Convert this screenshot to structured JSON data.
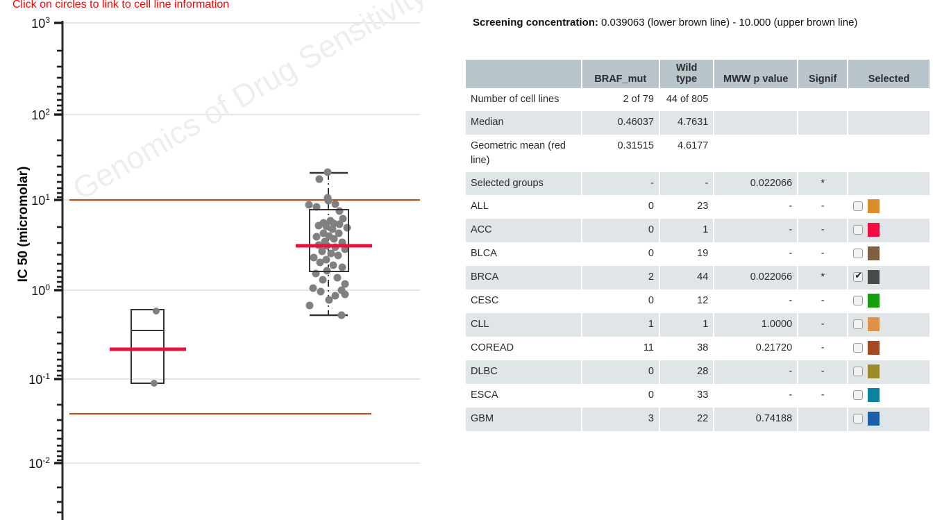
{
  "plot": {
    "title": "Click on circles to link to cell line information",
    "y_axis_label": "IC 50 (micromolar)",
    "watermark": "Genomics of Drug Sensitivity"
  },
  "info": {
    "screening_label": "Screening concentration:",
    "screening_value": " 0.039063 (lower brown line) - 10.000 (upper brown line)"
  },
  "table": {
    "headers": [
      "",
      "BRAF_mut",
      "Wild type",
      "MWW p value",
      "Signif",
      "Selected"
    ],
    "stat_rows": [
      {
        "label": "Number of cell lines",
        "braf": "2 of 79",
        "wild": "44 of 805",
        "mww": "",
        "signif": "",
        "alt": false
      },
      {
        "label": "Median",
        "braf": "0.46037",
        "wild": "4.7631",
        "mww": "",
        "signif": "",
        "alt": true
      },
      {
        "label": "Geometric mean (red line)",
        "braf": "0.31515",
        "wild": "4.6177",
        "mww": "",
        "signif": "",
        "alt": false
      },
      {
        "label": "Selected groups",
        "braf": "-",
        "wild": "-",
        "mww": "0.022066",
        "signif": "*",
        "alt": true
      }
    ],
    "tissue_rows": [
      {
        "label": "ALL",
        "braf": "0",
        "wild": "23",
        "mww": "-",
        "signif": "-",
        "checked": false,
        "color": "#d98d2b",
        "alt": false
      },
      {
        "label": "ACC",
        "braf": "0",
        "wild": "1",
        "mww": "-",
        "signif": "-",
        "checked": false,
        "color": "#f50a42",
        "alt": true
      },
      {
        "label": "BLCA",
        "braf": "0",
        "wild": "19",
        "mww": "-",
        "signif": "-",
        "checked": false,
        "color": "#7d6141",
        "alt": false
      },
      {
        "label": "BRCA",
        "braf": "2",
        "wild": "44",
        "mww": "0.022066",
        "signif": "*",
        "checked": true,
        "color": "#4a4a4a",
        "alt": true
      },
      {
        "label": "CESC",
        "braf": "0",
        "wild": "12",
        "mww": "-",
        "signif": "-",
        "checked": false,
        "color": "#159e0d",
        "alt": false
      },
      {
        "label": "CLL",
        "braf": "1",
        "wild": "1",
        "mww": "1.0000",
        "signif": "-",
        "checked": false,
        "color": "#dd9248",
        "alt": true
      },
      {
        "label": "COREAD",
        "braf": "11",
        "wild": "38",
        "mww": "0.21720",
        "signif": "-",
        "checked": false,
        "color": "#a44a22",
        "alt": false
      },
      {
        "label": "DLBC",
        "braf": "0",
        "wild": "28",
        "mww": "-",
        "signif": "-",
        "checked": false,
        "color": "#9c8b26",
        "alt": true
      },
      {
        "label": "ESCA",
        "braf": "0",
        "wild": "33",
        "mww": "-",
        "signif": "-",
        "checked": false,
        "color": "#0d81a0",
        "alt": false
      },
      {
        "label": "GBM",
        "braf": "3",
        "wild": "22",
        "mww": "0.74188",
        "signif": "",
        "checked": false,
        "color": "#1b5fa8",
        "alt": true
      }
    ]
  },
  "chart_data": {
    "type": "boxplot",
    "title": "Click on circles to link to cell line information",
    "ylabel": "IC 50 (micromolar)",
    "yscale": "log10",
    "ylim": [
      0.002,
      1000
    ],
    "ytick_labels": [
      "10³",
      "10²",
      "10¹",
      "10⁰",
      "10⁻¹",
      "10⁻²"
    ],
    "ytick_values": [
      1000,
      100,
      10,
      1,
      0.1,
      0.01
    ],
    "grid": "horizontal",
    "reference_lines": [
      {
        "name": "upper brown line (screening concentration max)",
        "value": 10.0,
        "color": "#b5531f"
      },
      {
        "name": "lower brown line (screening concentration min)",
        "value": 0.039063,
        "color": "#b5531f"
      }
    ],
    "groups": [
      {
        "name": "BRAF_mut",
        "n": 2,
        "median": 0.46037,
        "geometric_mean": 0.31515,
        "box_low": 0.127,
        "box_high": 0.81,
        "whisker_low": 0.127,
        "whisker_high": 0.81,
        "points": [
          0.81,
          0.127
        ]
      },
      {
        "name": "Wild type",
        "n": 44,
        "median": 4.7631,
        "geometric_mean": 4.6177,
        "box_low": 2.45,
        "box_high": 8.6,
        "whisker_low": 0.78,
        "whisker_high": 31.0,
        "points": [
          31.0,
          27.0,
          16.5,
          12.5,
          11.6,
          10.3,
          10.1,
          9.9,
          9.6,
          9.4,
          9.0,
          8.7,
          8.3,
          7.9,
          7.4,
          7.0,
          6.6,
          6.3,
          6.0,
          5.7,
          5.4,
          5.1,
          4.9,
          4.8,
          4.6,
          4.4,
          4.2,
          4.0,
          3.8,
          3.6,
          3.4,
          3.1,
          2.9,
          2.7,
          2.5,
          2.4,
          2.1,
          1.9,
          1.7,
          1.5,
          1.3,
          1.1,
          0.95,
          0.78
        ]
      }
    ],
    "legend": {
      "red_line": "Geometric mean",
      "brown_line": "Screening concentration bounds"
    }
  }
}
